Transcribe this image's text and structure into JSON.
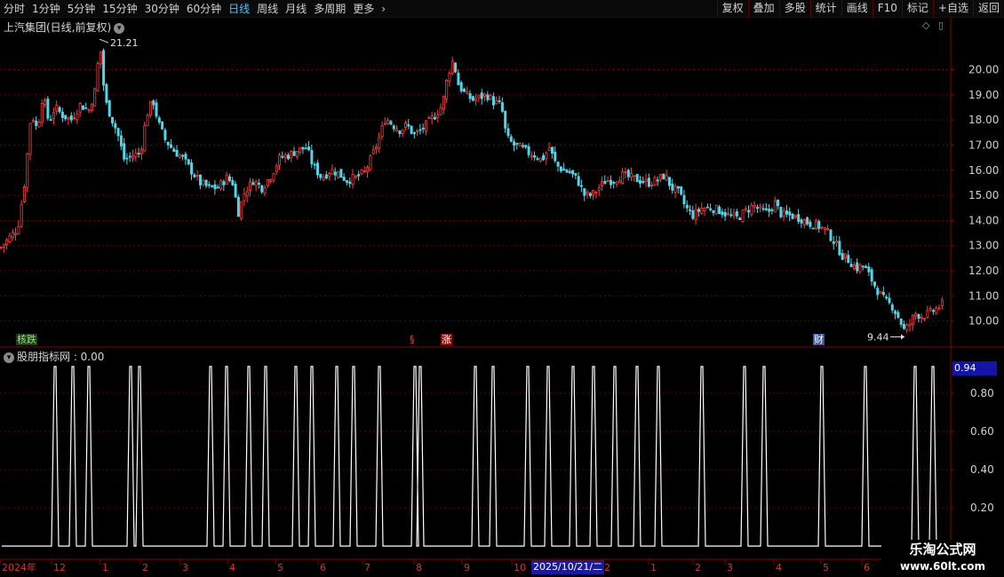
{
  "toolbar": {
    "periods": [
      "分时",
      "1分钟",
      "5分钟",
      "15分钟",
      "30分钟",
      "60分钟",
      "日线",
      "周线",
      "月线",
      "多周期",
      "更多"
    ],
    "active_period": "日线",
    "buttons": [
      "复权",
      "叠加",
      "多股",
      "统计",
      "画线",
      "F10",
      "标记",
      "+自选",
      "返回"
    ]
  },
  "chart_title": "上汽集团(日线,前复权)",
  "indicator_title": "股朋指标网 : 0.00",
  "indicator_value": "0.94",
  "highlight_date": "2025/10/21/二",
  "watermark": {
    "name": "乐淘公式网",
    "url": "www.60lt.com"
  },
  "event_tags": [
    {
      "label": "核跌",
      "color": "#9be07a",
      "bg": "#1c3a1c"
    },
    {
      "label": "§",
      "color": "#ff3c3c",
      "bg": "transparent"
    },
    {
      "label": "涨",
      "color": "#ffffff",
      "bg": "#8a1010"
    },
    {
      "label": "财",
      "color": "#ffffff",
      "bg": "#3a5a9a"
    }
  ],
  "chart_data": [
    {
      "type": "candlestick",
      "title": "上汽集团(日线,前复权)",
      "y_ticks": [
        "20.00",
        "19.00",
        "18.00",
        "17.00",
        "16.00",
        "15.00",
        "14.00",
        "13.00",
        "12.00",
        "11.00",
        "10.00"
      ],
      "ylim": [
        9.0,
        21.5
      ],
      "high_label": "21.21",
      "low_label": "9.44",
      "high_value": 21.21,
      "low_value": 9.44,
      "x_labels": [
        "2024年",
        "12",
        "1",
        "2",
        "3",
        "4",
        "5",
        "6",
        "7",
        "8",
        "9",
        "10",
        "2",
        "1",
        "2",
        "3",
        "4",
        "5",
        "6"
      ],
      "close_path": [
        [
          0,
          12.9
        ],
        [
          20,
          13.7
        ],
        [
          28,
          15.6
        ],
        [
          35,
          18.3
        ],
        [
          42,
          17.6
        ],
        [
          48,
          19.0
        ],
        [
          55,
          17.9
        ],
        [
          62,
          18.5
        ],
        [
          70,
          18.2
        ],
        [
          80,
          18.0
        ],
        [
          90,
          18.6
        ],
        [
          100,
          18.4
        ],
        [
          108,
          19.3
        ],
        [
          112,
          21.2
        ],
        [
          118,
          18.8
        ],
        [
          124,
          18.2
        ],
        [
          132,
          17.5
        ],
        [
          140,
          16.4
        ],
        [
          150,
          16.6
        ],
        [
          158,
          16.7
        ],
        [
          165,
          18.2
        ],
        [
          172,
          18.8
        ],
        [
          178,
          17.9
        ],
        [
          186,
          17.2
        ],
        [
          195,
          16.8
        ],
        [
          205,
          16.5
        ],
        [
          215,
          16.0
        ],
        [
          225,
          15.5
        ],
        [
          235,
          15.3
        ],
        [
          245,
          15.3
        ],
        [
          255,
          15.7
        ],
        [
          262,
          15.5
        ],
        [
          268,
          14.3
        ],
        [
          275,
          15.1
        ],
        [
          285,
          15.6
        ],
        [
          295,
          15.3
        ],
        [
          305,
          15.8
        ],
        [
          315,
          16.5
        ],
        [
          325,
          16.6
        ],
        [
          335,
          16.8
        ],
        [
          345,
          16.9
        ],
        [
          352,
          16.2
        ],
        [
          362,
          15.7
        ],
        [
          372,
          16.0
        ],
        [
          380,
          15.9
        ],
        [
          390,
          15.6
        ],
        [
          400,
          15.7
        ],
        [
          410,
          15.9
        ],
        [
          418,
          16.5
        ],
        [
          426,
          17.2
        ],
        [
          434,
          18.1
        ],
        [
          442,
          17.8
        ],
        [
          450,
          17.6
        ],
        [
          458,
          17.8
        ],
        [
          466,
          17.4
        ],
        [
          474,
          17.6
        ],
        [
          482,
          17.9
        ],
        [
          490,
          18.2
        ],
        [
          498,
          18.6
        ],
        [
          504,
          19.8
        ],
        [
          510,
          20.4
        ],
        [
          516,
          19.4
        ],
        [
          524,
          19.0
        ],
        [
          532,
          18.8
        ],
        [
          540,
          18.9
        ],
        [
          548,
          19.0
        ],
        [
          556,
          18.7
        ],
        [
          564,
          18.6
        ],
        [
          570,
          17.3
        ],
        [
          578,
          17.0
        ],
        [
          586,
          16.9
        ],
        [
          594,
          16.7
        ],
        [
          602,
          16.6
        ],
        [
          610,
          16.4
        ],
        [
          618,
          16.9
        ],
        [
          626,
          16.2
        ],
        [
          634,
          16.0
        ],
        [
          642,
          15.9
        ],
        [
          650,
          15.6
        ],
        [
          658,
          15.0
        ],
        [
          666,
          15.0
        ],
        [
          674,
          15.3
        ],
        [
          682,
          15.6
        ],
        [
          690,
          15.6
        ],
        [
          700,
          15.8
        ],
        [
          710,
          15.7
        ],
        [
          720,
          15.6
        ],
        [
          730,
          15.5
        ],
        [
          740,
          15.6
        ],
        [
          748,
          15.8
        ],
        [
          756,
          15.3
        ],
        [
          764,
          15.1
        ],
        [
          772,
          14.5
        ],
        [
          780,
          14.2
        ],
        [
          790,
          14.5
        ],
        [
          800,
          14.5
        ],
        [
          810,
          14.4
        ],
        [
          820,
          14.2
        ],
        [
          830,
          14.1
        ],
        [
          840,
          14.4
        ],
        [
          848,
          14.6
        ],
        [
          856,
          14.4
        ],
        [
          864,
          14.3
        ],
        [
          872,
          14.7
        ],
        [
          880,
          14.2
        ],
        [
          890,
          14.2
        ],
        [
          900,
          14.1
        ],
        [
          910,
          13.9
        ],
        [
          920,
          13.8
        ],
        [
          930,
          13.6
        ],
        [
          940,
          13.1
        ],
        [
          948,
          12.6
        ],
        [
          956,
          12.4
        ],
        [
          964,
          12.1
        ],
        [
          972,
          12.2
        ],
        [
          980,
          11.7
        ],
        [
          988,
          11.2
        ],
        [
          996,
          10.8
        ],
        [
          1004,
          10.6
        ],
        [
          1012,
          10.1
        ],
        [
          1018,
          9.6
        ],
        [
          1024,
          9.9
        ],
        [
          1030,
          10.3
        ],
        [
          1038,
          10.2
        ],
        [
          1046,
          10.3
        ],
        [
          1054,
          10.5
        ],
        [
          1062,
          10.7
        ]
      ]
    },
    {
      "type": "line",
      "title": "股朋指标网 : 0.00",
      "y_ticks": [
        "0.80",
        "0.60",
        "0.40",
        "0.20"
      ],
      "ylim": [
        -0.06,
        1.0
      ],
      "current_value": 0.94,
      "spike_value": 0.94,
      "spikes_x": [
        62,
        82,
        100,
        147,
        157,
        237,
        255,
        280,
        299,
        333,
        351,
        379,
        398,
        427,
        467,
        473,
        535,
        555,
        594,
        617,
        645,
        668,
        692,
        717,
        741,
        790,
        838,
        860,
        925,
        974,
        1030,
        1050
      ]
    }
  ]
}
